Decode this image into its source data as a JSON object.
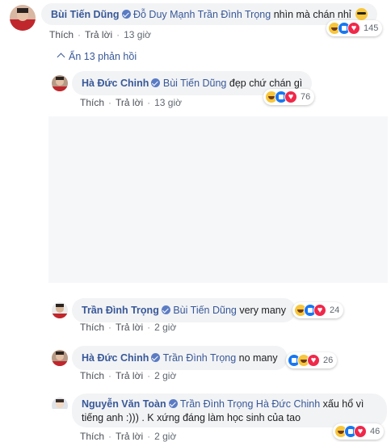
{
  "comments": [
    {
      "author": "Bùi Tiến Dũng",
      "tags": "Đỗ Duy Mạnh Trần Đình Trọng",
      "text": "nhìn mà chán nhỉ",
      "like_label": "Thích",
      "reply_label": "Trả lời",
      "time": "13 giờ",
      "reaction_count": "145",
      "reactions": [
        "haha-icon",
        "like-icon",
        "love-icon"
      ],
      "emoji": "cool-emoji-icon"
    },
    {
      "author": "Hà Đức Chinh",
      "tags": "Bùi Tiến Dũng",
      "text": "đẹp chứ chán gì",
      "like_label": "Thích",
      "reply_label": "Trả lời",
      "time": "13 giờ",
      "reaction_count": "76",
      "reactions": [
        "haha-icon",
        "like-icon",
        "love-icon"
      ]
    },
    {
      "author": "Trần Đình Trọng",
      "tags": "Bùi Tiến Dũng",
      "text": "very many",
      "like_label": "Thích",
      "reply_label": "Trả lời",
      "time": "2 giờ",
      "reaction_count": "24",
      "reactions": [
        "haha-icon",
        "like-icon",
        "love-icon"
      ]
    },
    {
      "author": "Hà Đức Chinh",
      "tags": "Trần Đình Trọng",
      "text": "no many",
      "like_label": "Thích",
      "reply_label": "Trả lời",
      "time": "2 giờ",
      "reaction_count": "26",
      "reactions": [
        "like-icon",
        "haha-icon",
        "love-icon"
      ]
    },
    {
      "author": "Nguyễn Văn Toàn",
      "tags": "Trần Đình Trọng Hà Đức Chinh",
      "text": "xấu hổ vì tiếng anh :))) . K xứng đáng làm học sinh của tao",
      "like_label": "Thích",
      "reply_label": "Trả lời",
      "time": "2 giờ",
      "reaction_count": "46",
      "reactions": [
        "haha-icon",
        "like-icon",
        "love-icon"
      ]
    }
  ],
  "hide_replies": "Ẩn 13 phản hồi",
  "colors": {
    "name": "#385898",
    "bubble": "#f2f3f5",
    "meta": "#606770",
    "media": "#f6f7f9"
  }
}
